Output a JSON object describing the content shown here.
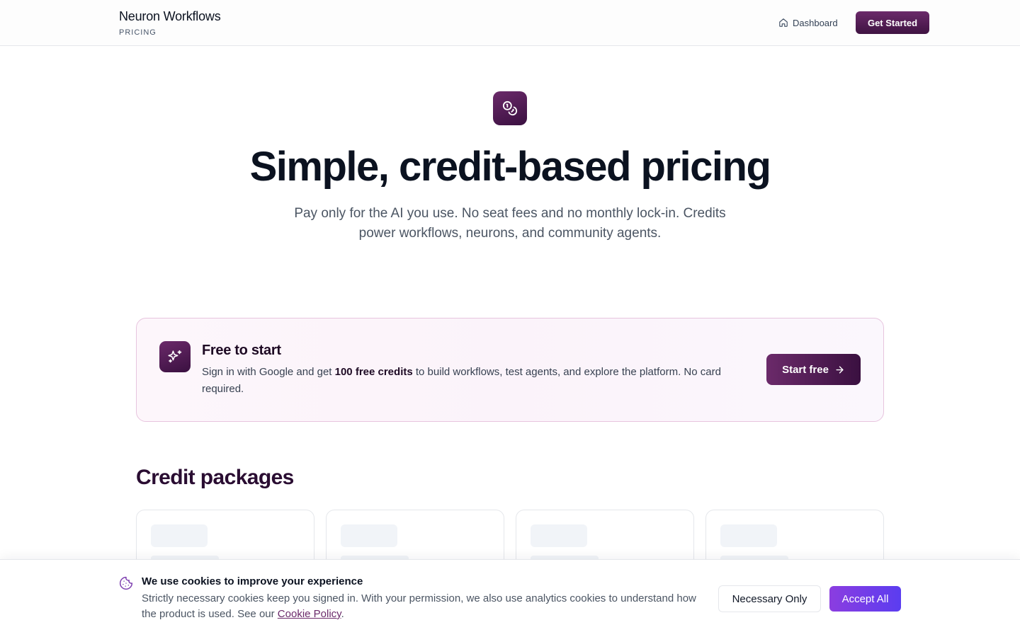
{
  "header": {
    "brand_title": "Neuron Workflows",
    "brand_subtitle": "PRICING",
    "nav_dashboard": "Dashboard",
    "get_started": "Get Started"
  },
  "hero": {
    "title": "Simple, credit-based pricing",
    "subtitle": "Pay only for the AI you use. No seat fees and no monthly lock-in. Credits power workflows, neurons, and community agents."
  },
  "free_card": {
    "title": "Free to start",
    "desc_before": "Sign in with Google and get ",
    "desc_bold": "100 free credits",
    "desc_after": " to build workflows, test agents, and explore the platform. No card required.",
    "button": "Start free"
  },
  "packages": {
    "title": "Credit packages",
    "count": 4
  },
  "cookie": {
    "title": "We use cookies to improve your experience",
    "text": "Strictly necessary cookies keep you signed in. With your permission, we also use analytics cookies to understand how the product is used. See our ",
    "link": "Cookie Policy",
    "text_end": ".",
    "necessary_button": "Necessary Only",
    "accept_button": "Accept All"
  },
  "colors": {
    "brand": "#6b2a6a",
    "brand_dark": "#3a1040",
    "accept_start": "#8b3de0",
    "accept_end": "#5b3df0"
  },
  "icons": {
    "nav": "home-icon",
    "hero": "coins-icon",
    "free": "sparkles-icon",
    "start": "arrow-right-icon",
    "cookie": "cookie-icon"
  }
}
